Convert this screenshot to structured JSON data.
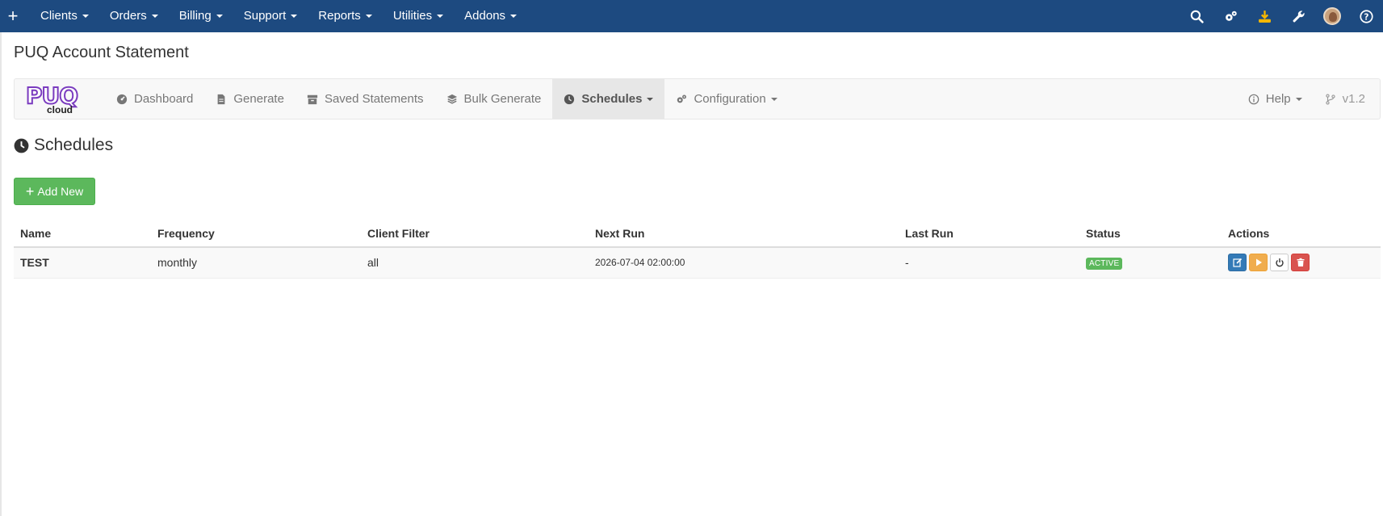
{
  "topbar": {
    "add_icon": "plus-icon",
    "menu": [
      {
        "label": "Clients"
      },
      {
        "label": "Orders"
      },
      {
        "label": "Billing"
      },
      {
        "label": "Support"
      },
      {
        "label": "Reports"
      },
      {
        "label": "Utilities"
      },
      {
        "label": "Addons"
      }
    ],
    "icons": [
      "search-icon",
      "gears-icon",
      "download-icon",
      "wrench-icon",
      "avatar",
      "help-icon"
    ],
    "background": "#1d4a80"
  },
  "page": {
    "title": "PUQ Account Statement"
  },
  "subnav": {
    "logo_text": "PUQ",
    "logo_subtext": "cloud",
    "items": [
      {
        "label": "Dashboard",
        "icon": "dashboard-icon"
      },
      {
        "label": "Generate",
        "icon": "file-icon"
      },
      {
        "label": "Saved Statements",
        "icon": "archive-icon"
      },
      {
        "label": "Bulk Generate",
        "icon": "layers-icon"
      },
      {
        "label": "Schedules",
        "icon": "clock-icon",
        "active": true
      },
      {
        "label": "Configuration",
        "icon": "gears-icon"
      }
    ],
    "help_label": "Help",
    "version_label": "v1.2"
  },
  "section": {
    "title": "Schedules",
    "icon": "clock-icon"
  },
  "add_button": {
    "label": "Add New"
  },
  "table": {
    "headers": [
      "Name",
      "Frequency",
      "Client Filter",
      "Next Run",
      "Last Run",
      "Status",
      "Actions"
    ],
    "rows": [
      {
        "name": "TEST",
        "frequency": "monthly",
        "client_filter": "all",
        "next_run": "2026-07-04 02:00:00",
        "last_run": "-",
        "status": "ACTIVE"
      }
    ]
  },
  "colors": {
    "success": "#5cb85c",
    "primary": "#337ab7",
    "warning": "#f0ad4e",
    "danger": "#d9534f"
  }
}
